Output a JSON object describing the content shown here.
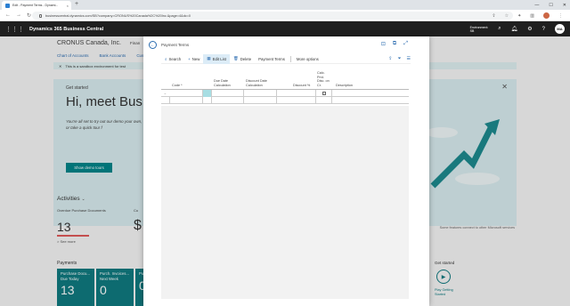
{
  "browser": {
    "tab_title": "Edit - Payment Terms - Dynami...",
    "tab_close": "×",
    "new_tab": "+",
    "url": "businesscentral.dynamics.com/SB?company=CRONUS%20Canada%2C%20Inc.&page=4&dc=0"
  },
  "bc": {
    "app_title": "Dynamics 365 Business Central",
    "environment_line1": "Environment:",
    "environment_line2": "SB",
    "user_initials": "MA"
  },
  "role_center": {
    "company": "CRONUS Canada, Inc.",
    "finance": "Finan",
    "nav_links": [
      "Chart of Accounts",
      "Bank Accounts",
      "Cust"
    ],
    "sandbox_text": "This is a sandbox environment for test",
    "get_started_label": "Get started",
    "get_started_heading": "Hi, meet Bus",
    "get_started_text": "You're all set to try out our demo your own, or take a quick tour f",
    "demo_button": "Show demo tours",
    "side_note": "Some features connect to other Microsoft services",
    "activities": "Activities",
    "cue1_label": "Overdue Purchase Documents",
    "cue1_value": "13",
    "cue1_link": "> See more",
    "cue2_label": "Cu",
    "cue2_value": "$",
    "payments": "Payments",
    "tiles": [
      {
        "label": "Purchase Docu... Due Today",
        "value": "13"
      },
      {
        "label": "Purch. Invoices... Next Week",
        "value": "0"
      },
      {
        "label": "Purch...",
        "value": "0"
      }
    ],
    "gs2_label": "Get started",
    "play_label": "Play Getting Started"
  },
  "dialog": {
    "caption": "Payment Terms",
    "actions": {
      "search": "Search",
      "new": "New",
      "edit_list": "Edit List",
      "delete": "Delete",
      "payment_terms": "Payment Terms",
      "more": "More options"
    },
    "columns": {
      "code": "Code *",
      "due_date": "Due Date Calculation",
      "discount_date": "Discount Date Calculation",
      "discount_pct": "Discount %",
      "calc_pmt": "Calc. Pmt. Disc. on Cr.",
      "description": "Description"
    },
    "row_arrow": "→"
  }
}
